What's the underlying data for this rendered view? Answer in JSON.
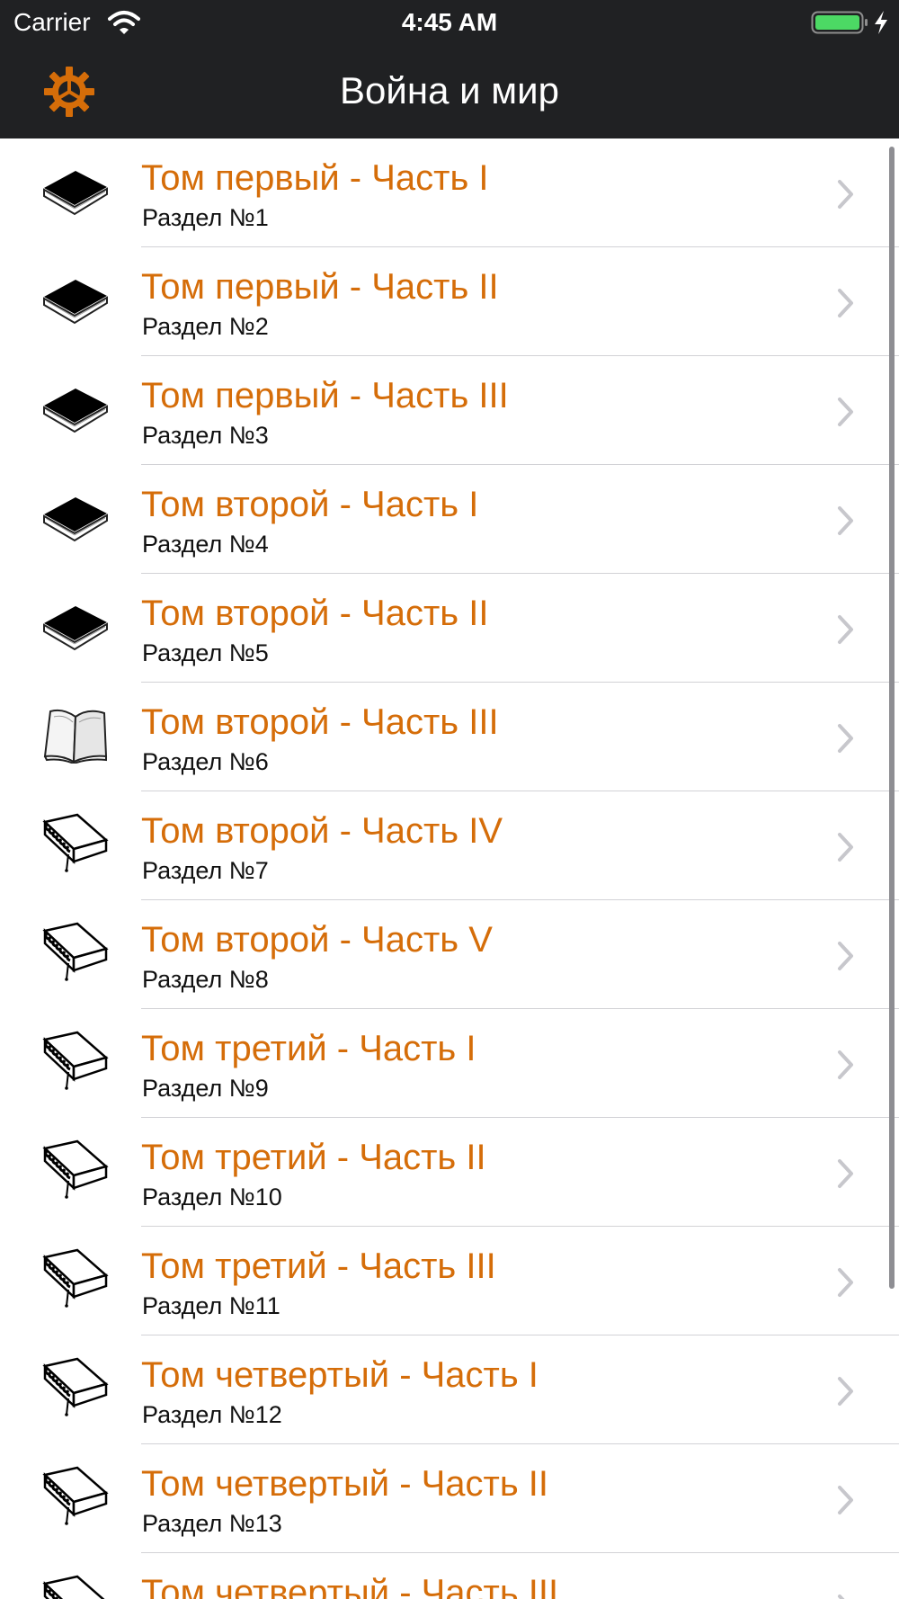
{
  "status_bar": {
    "carrier": "Carrier",
    "time": "4:45 AM"
  },
  "nav": {
    "title": "Война и мир",
    "settings_icon": "gear-icon",
    "accent_color": "#d56d09"
  },
  "list": {
    "items": [
      {
        "title": "Том первый - Часть I",
        "subtitle": "Раздел №1",
        "icon": "closed-book-icon"
      },
      {
        "title": "Том первый - Часть II",
        "subtitle": "Раздел №2",
        "icon": "closed-book-icon"
      },
      {
        "title": "Том первый - Часть III",
        "subtitle": "Раздел №3",
        "icon": "closed-book-icon"
      },
      {
        "title": "Том второй - Часть I",
        "subtitle": "Раздел №4",
        "icon": "closed-book-icon"
      },
      {
        "title": "Том второй - Часть II",
        "subtitle": "Раздел №5",
        "icon": "closed-book-icon"
      },
      {
        "title": "Том второй - Часть III",
        "subtitle": "Раздел №6",
        "icon": "open-book-icon"
      },
      {
        "title": "Том второй - Часть IV",
        "subtitle": "Раздел №7",
        "icon": "outline-book-icon"
      },
      {
        "title": "Том второй - Часть V",
        "subtitle": "Раздел №8",
        "icon": "outline-book-icon"
      },
      {
        "title": "Том третий - Часть I",
        "subtitle": "Раздел №9",
        "icon": "outline-book-icon"
      },
      {
        "title": "Том третий - Часть II",
        "subtitle": "Раздел №10",
        "icon": "outline-book-icon"
      },
      {
        "title": "Том третий - Часть III",
        "subtitle": "Раздел №11",
        "icon": "outline-book-icon"
      },
      {
        "title": "Том четвертый - Часть I",
        "subtitle": "Раздел №12",
        "icon": "outline-book-icon"
      },
      {
        "title": "Том четвертый - Часть II",
        "subtitle": "Раздел №13",
        "icon": "outline-book-icon"
      },
      {
        "title": "Том четвертый - Часть III",
        "subtitle": "",
        "icon": "outline-book-icon"
      }
    ]
  }
}
